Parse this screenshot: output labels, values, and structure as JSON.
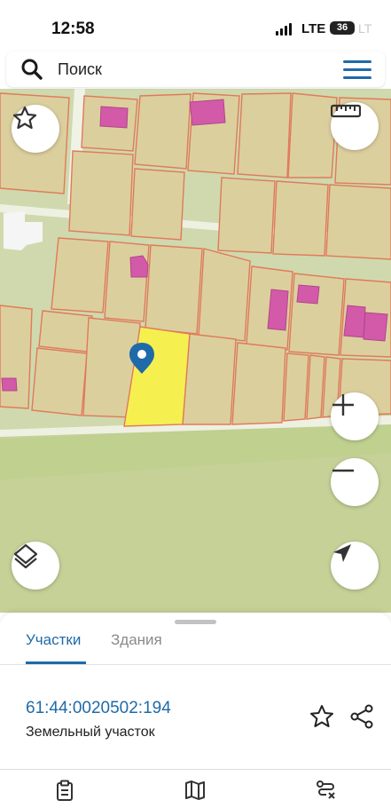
{
  "status_bar": {
    "time": "12:58",
    "network": "LTE",
    "battery": "36",
    "ghost_text": "LT"
  },
  "search": {
    "placeholder": "Поиск",
    "search_icon": "search-icon",
    "menu_icon": "hamburger-menu-icon"
  },
  "map": {
    "selected_parcel_color": "#f5f050",
    "parcel_border_color": "#e07a5a",
    "building_color": "#d25aa8",
    "pin_color": "#1f6aa8",
    "controls": {
      "favorite_icon": "star-icon",
      "ruler_icon": "ruler-icon",
      "zoom_in_icon": "plus-icon",
      "zoom_out_icon": "minus-icon",
      "layers_icon": "layers-icon",
      "location_icon": "navigation-arrow-icon"
    }
  },
  "sheet": {
    "tabs": [
      {
        "label": "Участки",
        "active": true
      },
      {
        "label": "Здания",
        "active": false
      }
    ],
    "result": {
      "cadastral_number": "61:44:0020502:194",
      "type": "Земельный участок"
    }
  },
  "colors": {
    "accent": "#1f6aa8",
    "tab_inactive": "#8a8a8a"
  }
}
